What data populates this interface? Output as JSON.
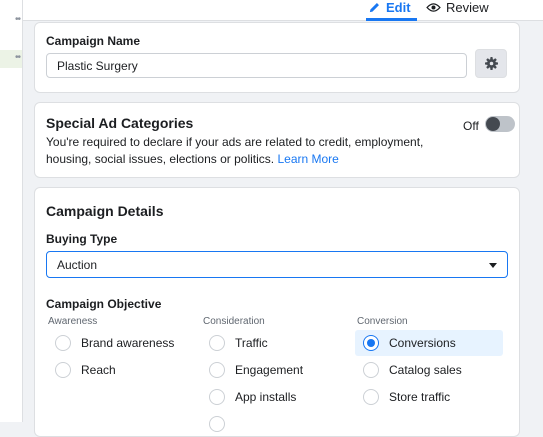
{
  "tabs": {
    "edit": "Edit",
    "review": "Review"
  },
  "campaign_name": {
    "label": "Campaign Name",
    "value": "Plastic Surgery"
  },
  "special_ad_categories": {
    "title": "Special Ad Categories",
    "description": "You're required to declare if your ads are related to credit, employment, housing, social issues, elections or politics.",
    "learn_more": "Learn More",
    "toggle_label": "Off",
    "toggle_state": "off"
  },
  "campaign_details": {
    "title": "Campaign Details",
    "buying_type_label": "Buying Type",
    "buying_type_value": "Auction",
    "objective_label": "Campaign Objective",
    "columns": {
      "awareness": {
        "label": "Awareness",
        "options": [
          "Brand awareness",
          "Reach"
        ]
      },
      "consideration": {
        "label": "Consideration",
        "options": [
          "Traffic",
          "Engagement",
          "App installs"
        ]
      },
      "conversion": {
        "label": "Conversion",
        "options": [
          "Conversions",
          "Catalog sales",
          "Store traffic"
        ]
      }
    },
    "selected": "Conversions"
  },
  "colors": {
    "accent": "#1877f2",
    "selected_bg": "#e7f3ff",
    "sidebar_selected_bg": "#ecf3e6"
  }
}
